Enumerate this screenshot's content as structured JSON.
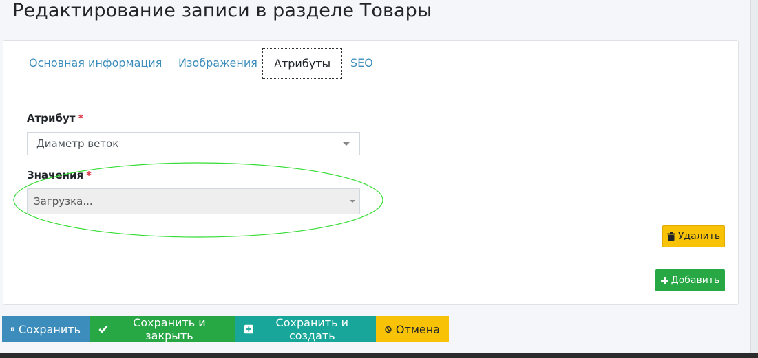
{
  "page": {
    "title": "Редактирование записи в разделе Товары"
  },
  "tabs": [
    {
      "label": "Основная информация"
    },
    {
      "label": "Изображения"
    },
    {
      "label": "Атрибуты"
    },
    {
      "label": "SEO"
    }
  ],
  "active_tab": "Атрибуты",
  "form": {
    "attribute_label": "Атрибут",
    "attribute_value": "Диаметр веток",
    "values_label": "Значения",
    "values_value": "Загрузка...",
    "required_mark": "*"
  },
  "buttons": {
    "delete": "Удалить",
    "add": "Добавить"
  },
  "footer": {
    "save": "Сохранить",
    "save_close": "Сохранить и закрыть",
    "save_new": "Сохранить и создать",
    "cancel": "Отмена"
  },
  "colors": {
    "link": "#3c8dbc",
    "primary": "#3c8dbc",
    "success": "#28a745",
    "teal": "#18a69a",
    "warning": "#f8c207",
    "required": "#dc3545",
    "annotation": "#33dd33"
  }
}
